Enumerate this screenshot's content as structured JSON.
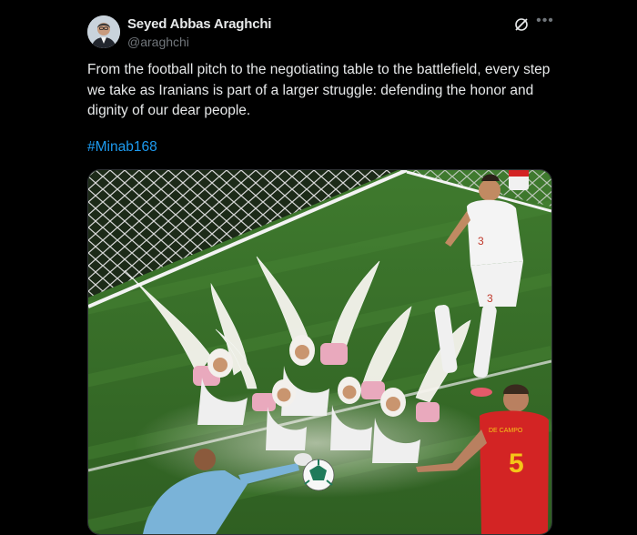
{
  "author": {
    "name": "Seyed Abbas Araghchi",
    "handle": "@araghchi"
  },
  "icons": {
    "grok": "grok-icon",
    "more": "more-options-icon"
  },
  "tweet": {
    "text": "From the football pitch to the negotiating table to the battlefield, every step we take as Iranians is part of a larger struggle: defending the honor and dignity of our dear people.",
    "hashtag": "#Minab168"
  },
  "media": {
    "player_numbers": [
      "3",
      "3",
      "5"
    ],
    "shirt_name": "DE CAMPO"
  },
  "colors": {
    "background": "#000000",
    "text": "#e7e9ea",
    "secondary": "#71767b",
    "link": "#1d9bf0"
  }
}
